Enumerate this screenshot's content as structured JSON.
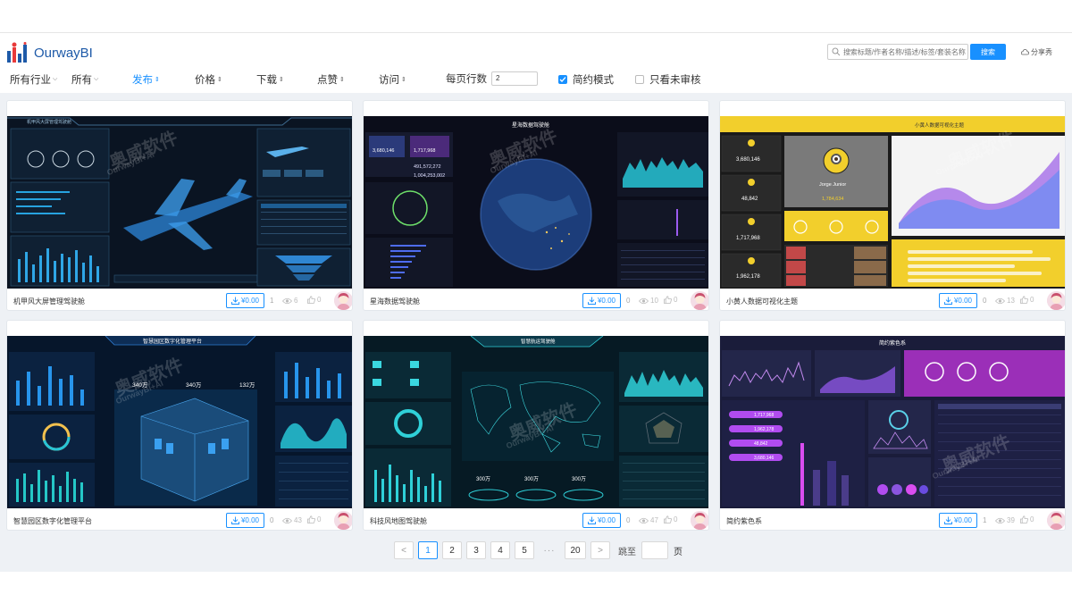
{
  "app": {
    "logo_text": "OurwayBI",
    "search_placeholder": "搜索标题/作者名称/描述/标签/套装名称",
    "search_button": "搜索",
    "share_label": "分享秀"
  },
  "filters": {
    "industry": "所有行业",
    "all": "所有",
    "publish": "发布",
    "price": "价格",
    "download": "下载",
    "likes": "点赞",
    "visits": "访问",
    "per_page_label": "每页行数",
    "per_page_value": "2",
    "simple_mode_label": "简约模式",
    "simple_mode_checked": true,
    "unreviewed_label": "只看未审核",
    "unreviewed_checked": false
  },
  "watermark": {
    "brand": "奥威软件",
    "sub": "OurwayBI+AI"
  },
  "cards": [
    {
      "title": "机甲风大屏管理驾驶舱",
      "price": "¥0.00",
      "downloads": "1",
      "views": "6",
      "likes": "0",
      "theme": "mech"
    },
    {
      "title": "星海数据驾驶舱",
      "price": "¥0.00",
      "downloads": "0",
      "views": "10",
      "likes": "0",
      "theme": "star"
    },
    {
      "title": "小黄人数据可视化主题",
      "price": "¥0.00",
      "downloads": "0",
      "views": "13",
      "likes": "0",
      "theme": "yellow"
    },
    {
      "title": "智慧园区数字化管理平台",
      "price": "¥0.00",
      "downloads": "0",
      "views": "43",
      "likes": "0",
      "theme": "park"
    },
    {
      "title": "科技风地图驾驶舱",
      "price": "¥0.00",
      "downloads": "0",
      "views": "47",
      "likes": "0",
      "theme": "map"
    },
    {
      "title": "简约紫色系",
      "price": "¥0.00",
      "downloads": "1",
      "views": "39",
      "likes": "0",
      "theme": "purple"
    }
  ],
  "thumb_text": {
    "star_title": "星海数据驾驶舱",
    "star_v1": "3,680,146",
    "star_v2": "1,717,968",
    "star_v3": "491,572,272",
    "star_v4": "1,004,253,002",
    "yellow_title": "小黄人数据可视化主题",
    "yellow_v1": "3,680,146",
    "yellow_v2": "48,842",
    "yellow_v3": "1,717,968",
    "yellow_v4": "1,962,178",
    "yellow_name": "Jorge Junior",
    "yellow_score": "1,784,634",
    "park_title": "智慧园区数字化管理平台",
    "park_v1": "340万",
    "park_v2": "340万",
    "park_v3": "132万",
    "map_title": "智慧航运驾驶舱",
    "map_v1": "300万",
    "map_v2": "300万",
    "map_v3": "300万",
    "purple_title": "简约紫色系",
    "purple_v1": "1,717,968",
    "purple_v2": "1,962,178",
    "purple_v3": "48,842",
    "purple_v4": "3,680,146"
  },
  "pagination": {
    "prev": "<",
    "pages": [
      "1",
      "2",
      "3",
      "4",
      "5"
    ],
    "dots": "···",
    "last": "20",
    "next": ">",
    "jump_label": "跳至",
    "page_suffix": "页",
    "current": "1"
  }
}
